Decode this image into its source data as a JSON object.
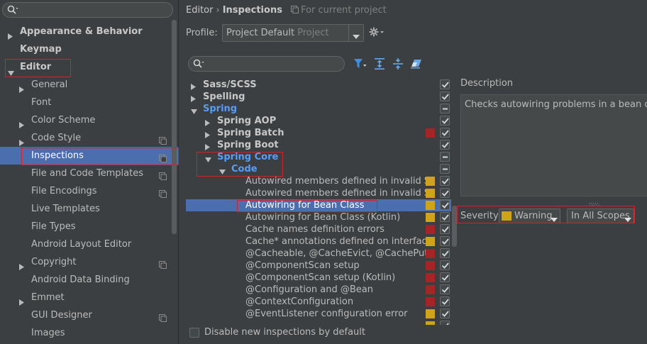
{
  "colors": {
    "background": "#3c3f41",
    "selection": "#4b6eaf",
    "link_blue": "#589df6",
    "warning": "#d0a419",
    "error": "#a52527",
    "highlight_box": "#d8202a"
  },
  "left_tree": {
    "items": [
      {
        "label": "Appearance & Behavior",
        "expanded": false,
        "has_arrow": true,
        "bold": true
      },
      {
        "label": "Keymap",
        "bold": true
      },
      {
        "label": "Editor",
        "expanded": true,
        "has_arrow": true,
        "bold": true
      },
      {
        "label": "General",
        "has_arrow": true
      },
      {
        "label": "Font"
      },
      {
        "label": "Color Scheme",
        "has_arrow": true
      },
      {
        "label": "Code Style",
        "has_arrow": true,
        "project_icon": "project-scope-icon"
      },
      {
        "label": "Inspections",
        "selected": true,
        "project_icon": "project-scope-icon"
      },
      {
        "label": "File and Code Templates",
        "project_icon": "project-scope-icon"
      },
      {
        "label": "File Encodings",
        "project_icon": "project-scope-icon"
      },
      {
        "label": "Live Templates"
      },
      {
        "label": "File Types"
      },
      {
        "label": "Android Layout Editor"
      },
      {
        "label": "Copyright",
        "has_arrow": true,
        "project_icon": "project-scope-icon"
      },
      {
        "label": "Android Data Binding"
      },
      {
        "label": "Emmet",
        "has_arrow": true
      },
      {
        "label": "GUI Designer",
        "project_icon": "project-scope-icon"
      },
      {
        "label": "Images"
      }
    ]
  },
  "breadcrumb": {
    "parent": "Editor",
    "separator": "›",
    "current": "Inspections",
    "scope_note": "For current project"
  },
  "profile": {
    "label": "Profile:",
    "value": "Project Default",
    "sub": "Project"
  },
  "icons": {
    "search": "search-icon",
    "filter": "filter-icon",
    "expand_all": "expand-all-icon",
    "collapse_all": "collapse-all-icon",
    "reset": "eraser-icon",
    "settings": "gear-icon"
  },
  "inspection_tree": [
    {
      "label": "Sass/SCSS",
      "depth": 0,
      "type": "folder",
      "expanded": false,
      "check": "checked"
    },
    {
      "label": "Spelling",
      "depth": 0,
      "type": "folder",
      "expanded": false,
      "check": "checked"
    },
    {
      "label": "Spring",
      "depth": 0,
      "type": "folder",
      "expanded": true,
      "blue": true,
      "check": "partial"
    },
    {
      "label": "Spring AOP",
      "depth": 1,
      "type": "folder",
      "expanded": false,
      "check": "checked"
    },
    {
      "label": "Spring Batch",
      "depth": 1,
      "type": "folder",
      "expanded": false,
      "severity": "error",
      "check": "checked"
    },
    {
      "label": "Spring Boot",
      "depth": 1,
      "type": "folder",
      "expanded": false,
      "check": "checked"
    },
    {
      "label": "Spring Core",
      "depth": 1,
      "type": "folder",
      "expanded": true,
      "blue": true,
      "check": "partial"
    },
    {
      "label": "Code",
      "depth": 2,
      "type": "folder",
      "expanded": true,
      "blue": true,
      "check": "partial"
    },
    {
      "label": "Autowired members defined in invalid Spring bean",
      "type": "leaf",
      "severity": "warning",
      "check": "checked"
    },
    {
      "label": "Autowired members defined in invalid Spring bean (Kotlin)",
      "type": "leaf",
      "severity": "warning",
      "check": "checked"
    },
    {
      "label": "Autowiring for Bean Class",
      "type": "leaf",
      "severity": "warning",
      "check": "checked",
      "selected": true
    },
    {
      "label": "Autowiring for Bean Class (Kotlin)",
      "type": "leaf",
      "severity": "warning",
      "check": "checked"
    },
    {
      "label": "Cache names definition errors",
      "type": "leaf",
      "severity": "error",
      "check": "checked"
    },
    {
      "label": "Cache* annotations defined on interfaces/interface methods",
      "type": "leaf",
      "severity": "warning",
      "check": "checked"
    },
    {
      "label": "@Cacheable, @CacheEvict, @CachePut, @CacheConfig",
      "type": "leaf",
      "severity": "error",
      "check": "checked"
    },
    {
      "label": "@ComponentScan setup",
      "type": "leaf",
      "severity": "error",
      "check": "checked"
    },
    {
      "label": "@ComponentScan setup (Kotlin)",
      "type": "leaf",
      "severity": "error",
      "check": "checked"
    },
    {
      "label": "@Configuration and @Bean",
      "type": "leaf",
      "severity": "error",
      "check": "checked"
    },
    {
      "label": "@ContextConfiguration",
      "type": "leaf",
      "severity": "error",
      "check": "checked"
    },
    {
      "label": "@EventListener configuration error",
      "type": "leaf",
      "severity": "warning",
      "check": "checked"
    },
    {
      "label": "",
      "type": "leaf",
      "severity": "warning",
      "check": "checked"
    }
  ],
  "description": {
    "title": "Description",
    "text": "Checks autowiring problems in a bean class."
  },
  "severity": {
    "label": "Severity:",
    "value": "Warning",
    "scope": "In All Scopes"
  },
  "bottom": {
    "checkbox_label": "Disable new inspections by default",
    "checked": false
  }
}
